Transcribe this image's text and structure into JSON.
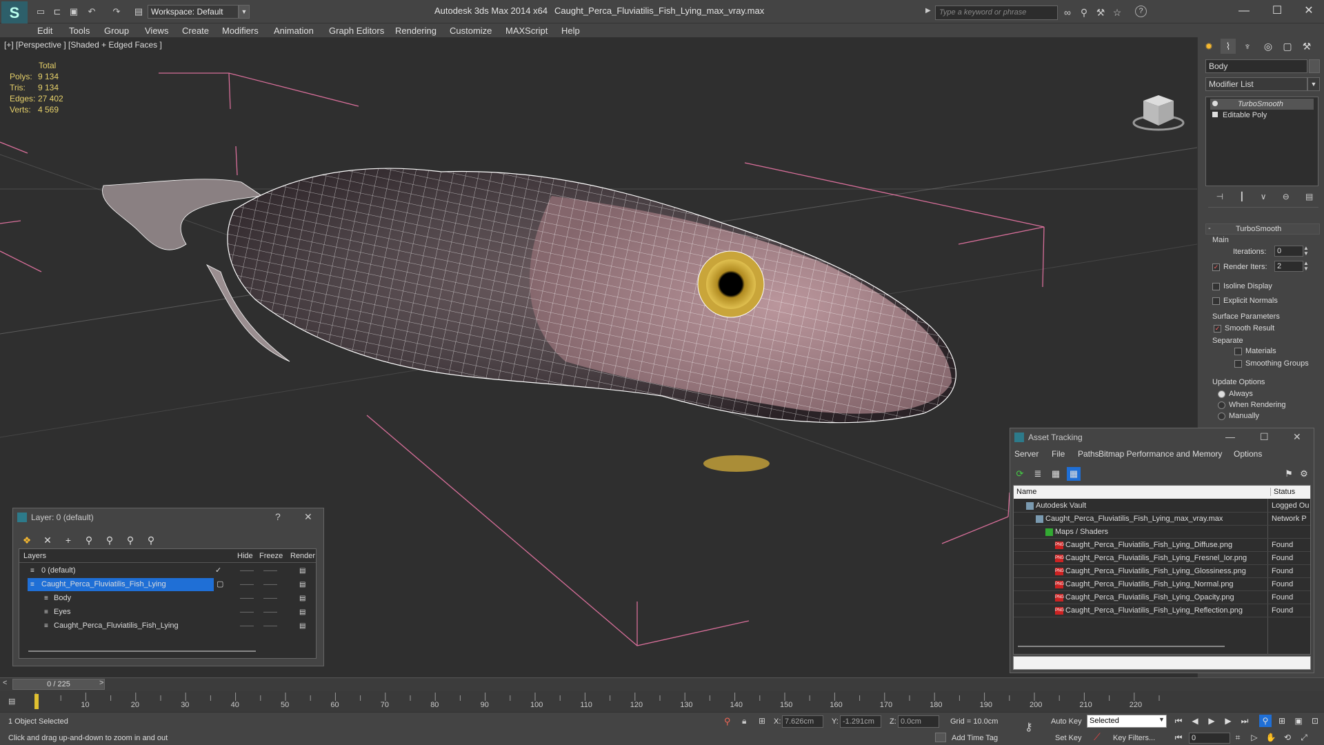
{
  "app": {
    "name": "Autodesk 3ds Max  2014 x64",
    "file": "Caught_Perca_Fluviatilis_Fish_Lying_max_vray.max",
    "workspace": "Workspace: Default",
    "search_placeholder": "Type a keyword or phrase",
    "help_glyph": "?"
  },
  "menu": [
    "Edit",
    "Tools",
    "Group",
    "Views",
    "Create",
    "Modifiers",
    "Animation",
    "Graph Editors",
    "Rendering",
    "Customize",
    "MAXScript",
    "Help"
  ],
  "viewport": {
    "label": "[+] [Perspective ] [Shaded + Edged Faces ]",
    "stats_header": "Total",
    "stats": [
      {
        "label": "Polys:",
        "value": "9 134"
      },
      {
        "label": "Tris:",
        "value": "9 134"
      },
      {
        "label": "Edges:",
        "value": "27 402"
      },
      {
        "label": "Verts:",
        "value": "4 569"
      }
    ]
  },
  "command_panel": {
    "object_name": "Body",
    "modifier_list": "Modifier List",
    "stack": [
      "TurboSmooth",
      "Editable Poly"
    ],
    "rollout_title": "TurboSmooth",
    "collapse_glyph": "-",
    "main_group": "Main",
    "iterations_label": "Iterations:",
    "iterations_value": "0",
    "render_iters_label": "Render Iters:",
    "render_iters_value": "2",
    "isoline_display": "Isoline Display",
    "explicit_normals": "Explicit Normals",
    "surface_params": "Surface Parameters",
    "smooth_result": "Smooth Result",
    "separate": "Separate",
    "materials": "Materials",
    "smoothing_groups": "Smoothing Groups",
    "update_options": "Update Options",
    "always": "Always",
    "when_rendering": "When Rendering",
    "manually": "Manually"
  },
  "layer_window": {
    "title": "Layer: 0 (default)",
    "help_glyph": "?",
    "columns": [
      "Layers",
      "Hide",
      "Freeze",
      "Render"
    ],
    "rows": [
      {
        "name": "0 (default)",
        "indent": 0,
        "checked": true,
        "selected": false
      },
      {
        "name": "Caught_Perca_Fluviatilis_Fish_Lying",
        "indent": 0,
        "checked": false,
        "selected": true
      },
      {
        "name": "Body",
        "indent": 1,
        "checked": false,
        "selected": false
      },
      {
        "name": "Eyes",
        "indent": 1,
        "checked": false,
        "selected": false
      },
      {
        "name": "Caught_Perca_Fluviatilis_Fish_Lying",
        "indent": 1,
        "checked": false,
        "selected": false
      }
    ]
  },
  "asset_window": {
    "title": "Asset Tracking",
    "menu": [
      "Server",
      "File",
      "Paths",
      "Bitmap Performance and Memory",
      "Options"
    ],
    "columns": [
      "Name",
      "Status"
    ],
    "rows": [
      {
        "name": "Autodesk Vault",
        "status": "Logged Ou",
        "indent": 1
      },
      {
        "name": "Caught_Perca_Fluviatilis_Fish_Lying_max_vray.max",
        "status": "Network P",
        "indent": 2
      },
      {
        "name": "Maps / Shaders",
        "status": "",
        "indent": 3
      },
      {
        "name": "Caught_Perca_Fluviatilis_Fish_Lying_Diffuse.png",
        "status": "Found",
        "indent": 4
      },
      {
        "name": "Caught_Perca_Fluviatilis_Fish_Lying_Fresnel_Ior.png",
        "status": "Found",
        "indent": 4
      },
      {
        "name": "Caught_Perca_Fluviatilis_Fish_Lying_Glossiness.png",
        "status": "Found",
        "indent": 4
      },
      {
        "name": "Caught_Perca_Fluviatilis_Fish_Lying_Normal.png",
        "status": "Found",
        "indent": 4
      },
      {
        "name": "Caught_Perca_Fluviatilis_Fish_Lying_Opacity.png",
        "status": "Found",
        "indent": 4
      },
      {
        "name": "Caught_Perca_Fluviatilis_Fish_Lying_Reflection.png",
        "status": "Found",
        "indent": 4
      }
    ],
    "png_badge": "PNG"
  },
  "timeline": {
    "frame": "0 / 225",
    "ticks": [
      "10",
      "20",
      "30",
      "40",
      "50",
      "60",
      "70",
      "80",
      "90",
      "100",
      "110",
      "120",
      "130",
      "140",
      "150",
      "160",
      "170",
      "180",
      "190",
      "200",
      "210",
      "220"
    ]
  },
  "status": {
    "selection": "1 Object Selected",
    "prompt": "Click and drag up-and-down to zoom in and out",
    "x_label": "X:",
    "x": "7.626cm",
    "y_label": "Y:",
    "y": "-1.291cm",
    "z_label": "Z:",
    "z": "0.0cm",
    "grid": "Grid = 10.0cm",
    "auto_key": "Auto Key",
    "set_key": "Set Key",
    "selected": "Selected",
    "key_filters": "Key Filters...",
    "add_time_tag": "Add Time Tag",
    "current_frame": "0"
  },
  "colors": {
    "accent": "#1f6fd6",
    "grid": "#d86f9a",
    "wire": "#ffffff"
  }
}
